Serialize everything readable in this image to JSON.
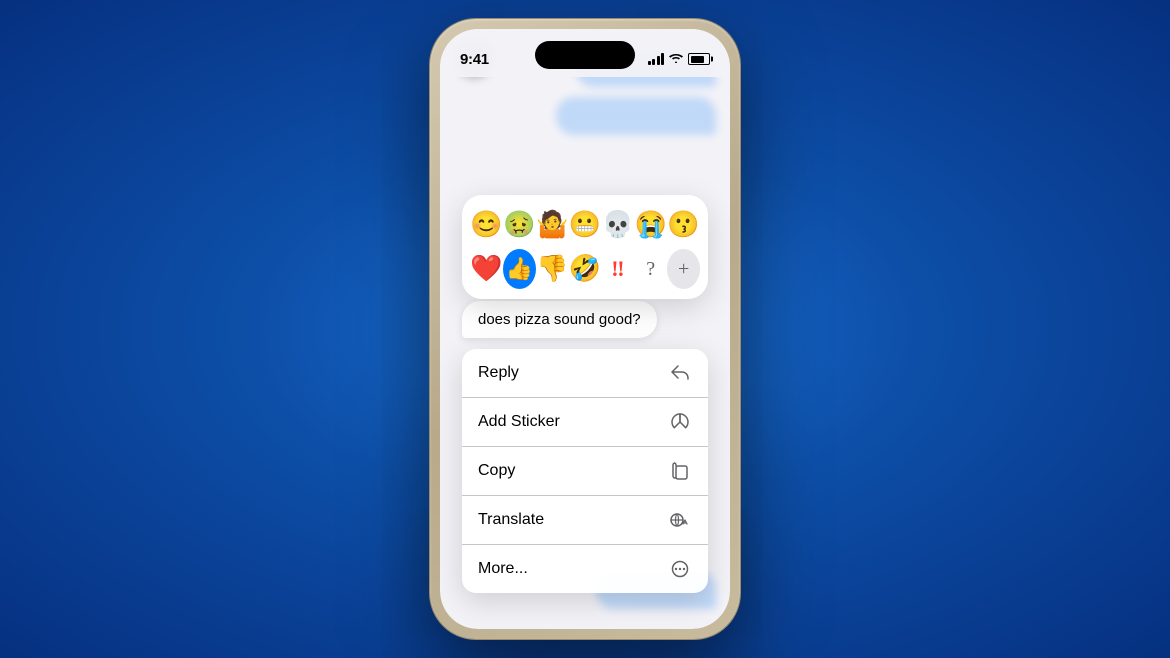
{
  "phone": {
    "status_bar": {
      "time": "9:41"
    },
    "emoji_picker": {
      "row1": [
        {
          "emoji": "😊",
          "id": "smiling-face"
        },
        {
          "emoji": "🤢",
          "id": "nauseated-face"
        },
        {
          "emoji": "🤷",
          "id": "shrug"
        },
        {
          "emoji": "😬",
          "id": "grimacing-face"
        },
        {
          "emoji": "💀",
          "id": "skull"
        },
        {
          "emoji": "😭",
          "id": "crying-face"
        },
        {
          "emoji": "😗",
          "id": "kissing-face"
        }
      ],
      "row2": [
        {
          "emoji": "❤️",
          "id": "red-heart"
        },
        {
          "emoji": "👍",
          "id": "thumbs-up",
          "active": true
        },
        {
          "emoji": "👎",
          "id": "thumbs-down"
        },
        {
          "emoji": "🤣",
          "id": "rolling-laughing"
        },
        {
          "emoji": "‼",
          "id": "double-exclaim",
          "special": "red-exclaim"
        },
        {
          "emoji": "?",
          "id": "question",
          "special": "question"
        },
        {
          "emoji": "+",
          "id": "plus",
          "special": "plus"
        }
      ],
      "plus_label": "+"
    },
    "message": {
      "text": "does pizza sound good?"
    },
    "context_menu": {
      "items": [
        {
          "label": "Reply",
          "icon": "reply-icon"
        },
        {
          "label": "Add Sticker",
          "icon": "sticker-icon"
        },
        {
          "label": "Copy",
          "icon": "copy-icon"
        },
        {
          "label": "Translate",
          "icon": "translate-icon"
        },
        {
          "label": "More...",
          "icon": "more-icon"
        }
      ]
    }
  }
}
